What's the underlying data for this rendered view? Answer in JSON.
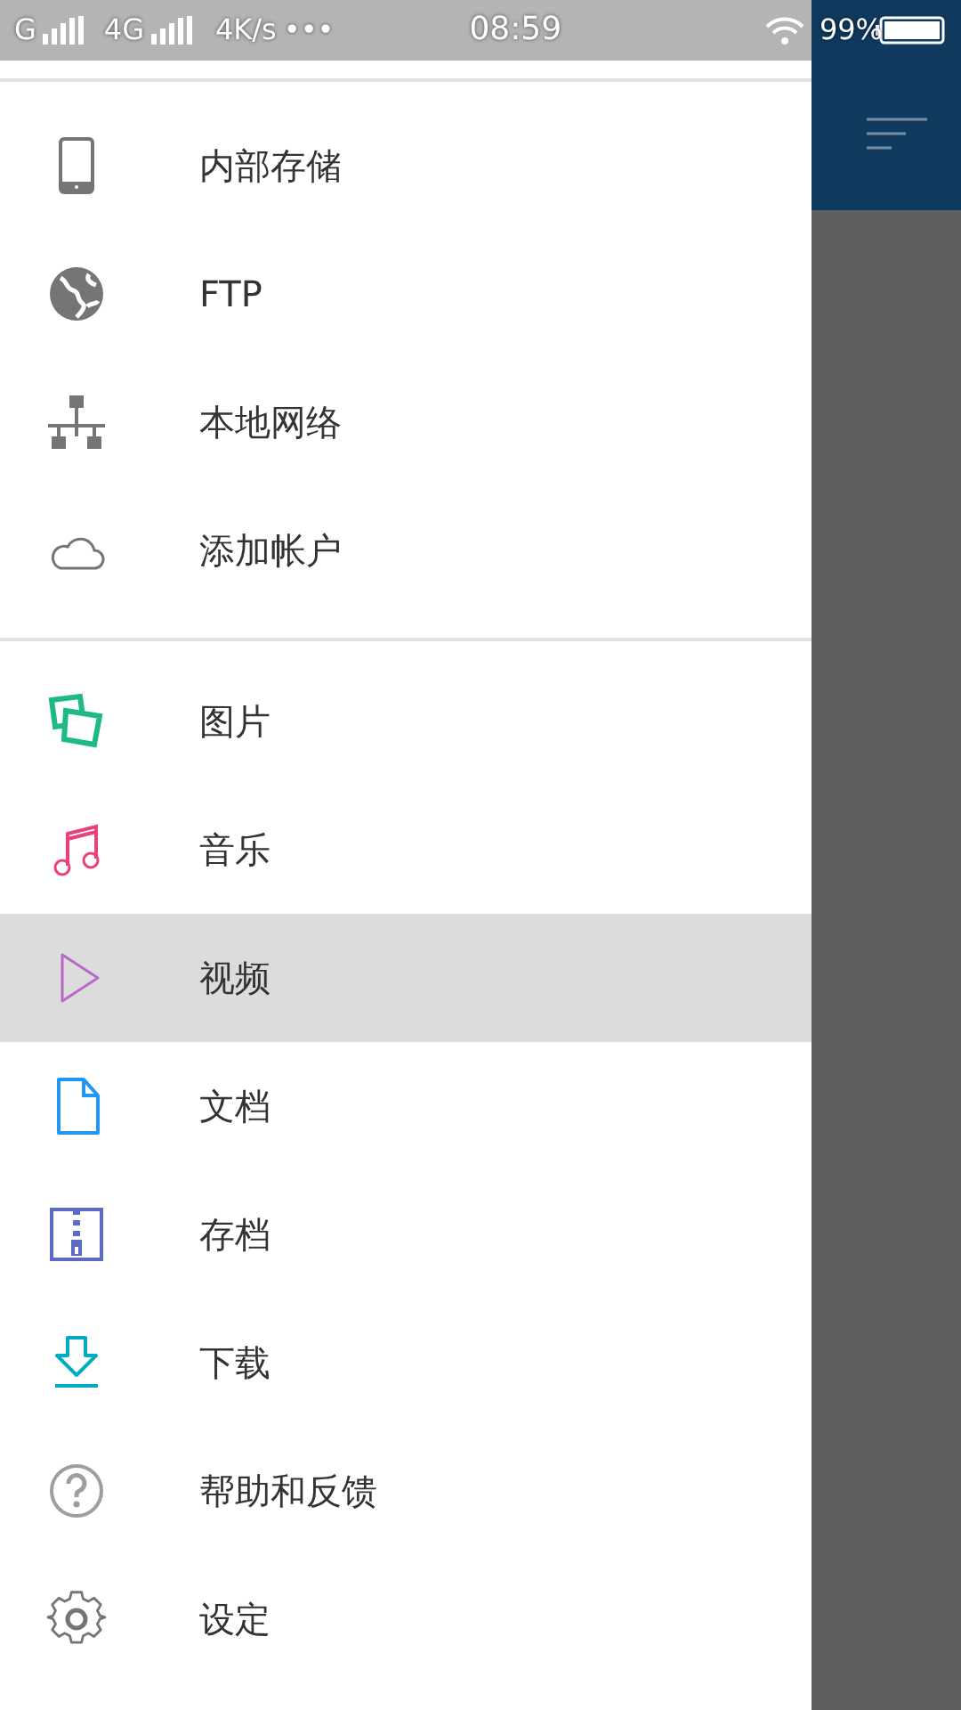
{
  "status_bar": {
    "sim1": "G",
    "sim2": "4G",
    "speed": "4K/s",
    "more": "•••",
    "time": "08:59",
    "battery": "99%"
  },
  "sections": [
    {
      "items": [
        {
          "kind": "phone",
          "label": "内部存储",
          "color": "#757575",
          "selected": false
        },
        {
          "kind": "globe",
          "label": "FTP",
          "color": "#757575",
          "selected": false
        },
        {
          "kind": "network",
          "label": "本地网络",
          "color": "#757575",
          "selected": false
        },
        {
          "kind": "cloud",
          "label": "添加帐户",
          "color": "#757575",
          "selected": false
        }
      ]
    },
    {
      "items": [
        {
          "kind": "images",
          "label": "图片",
          "color": "#1dba82",
          "selected": false
        },
        {
          "kind": "music",
          "label": "音乐",
          "color": "#ec407a",
          "selected": false
        },
        {
          "kind": "play",
          "label": "视频",
          "color": "#ba68c8",
          "selected": true
        },
        {
          "kind": "document",
          "label": "文档",
          "color": "#2196f3",
          "selected": false
        },
        {
          "kind": "archive",
          "label": "存档",
          "color": "#5c6bc0",
          "selected": false
        },
        {
          "kind": "download",
          "label": "下载",
          "color": "#00acc1",
          "selected": false
        },
        {
          "kind": "help",
          "label": "帮助和反馈",
          "color": "#9e9e9e",
          "selected": false
        },
        {
          "kind": "settings",
          "label": "设定",
          "color": "#757575",
          "selected": false
        }
      ]
    }
  ]
}
